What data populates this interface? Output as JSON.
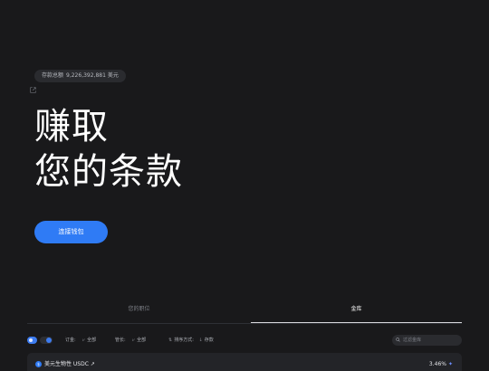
{
  "stats": {
    "deposits_label": "存款总额",
    "deposits_value": "9,226,392,881 美元"
  },
  "hero": {
    "line1": "赚取",
    "line2": "您的条款"
  },
  "connect_wallet": "连接钱包",
  "tabs": [
    {
      "label": "您的职位",
      "active": false
    },
    {
      "label": "金库",
      "active": true
    }
  ],
  "filters": {
    "deposit_label": "订金:",
    "deposit_value": "全部",
    "curator_label": "管长:",
    "curator_value": "全部",
    "sort_label": "排序方式:",
    "sort_value": "存款",
    "search_placeholder": "过滤金库"
  },
  "vault_row": {
    "name": "美元生物性 USDC ↗",
    "apy": "3.46%"
  },
  "colors": {
    "background": "#19191b",
    "accent": "#2f7bf5"
  }
}
